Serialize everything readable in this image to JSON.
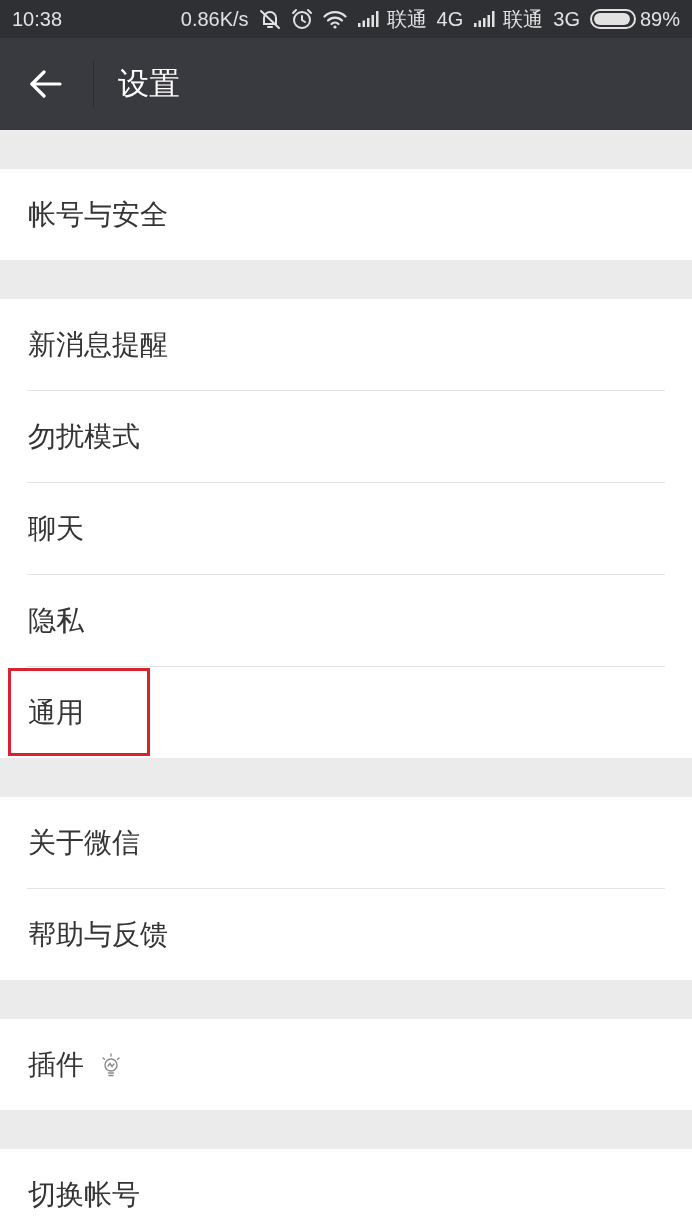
{
  "status_bar": {
    "time": "10:38",
    "speed": "0.86K/s",
    "carriers": [
      {
        "name": "联通",
        "network": "4G"
      },
      {
        "name": "联通",
        "network": "3G"
      }
    ],
    "battery": "89%"
  },
  "header": {
    "title": "设置"
  },
  "groups": [
    {
      "items": [
        {
          "label": "帐号与安全",
          "kind": "plain",
          "highlighted": false
        }
      ]
    },
    {
      "items": [
        {
          "label": "新消息提醒",
          "kind": "plain",
          "highlighted": false
        },
        {
          "label": "勿扰模式",
          "kind": "plain",
          "highlighted": false
        },
        {
          "label": "聊天",
          "kind": "plain",
          "highlighted": false
        },
        {
          "label": "隐私",
          "kind": "plain",
          "highlighted": false
        },
        {
          "label": "通用",
          "kind": "plain",
          "highlighted": true
        }
      ]
    },
    {
      "items": [
        {
          "label": "关于微信",
          "kind": "plain",
          "highlighted": false
        },
        {
          "label": "帮助与反馈",
          "kind": "plain",
          "highlighted": false
        }
      ]
    },
    {
      "items": [
        {
          "label": "插件",
          "kind": "bulb",
          "highlighted": false
        }
      ]
    },
    {
      "items": [
        {
          "label": "切换帐号",
          "kind": "plain",
          "highlighted": false
        }
      ]
    }
  ]
}
